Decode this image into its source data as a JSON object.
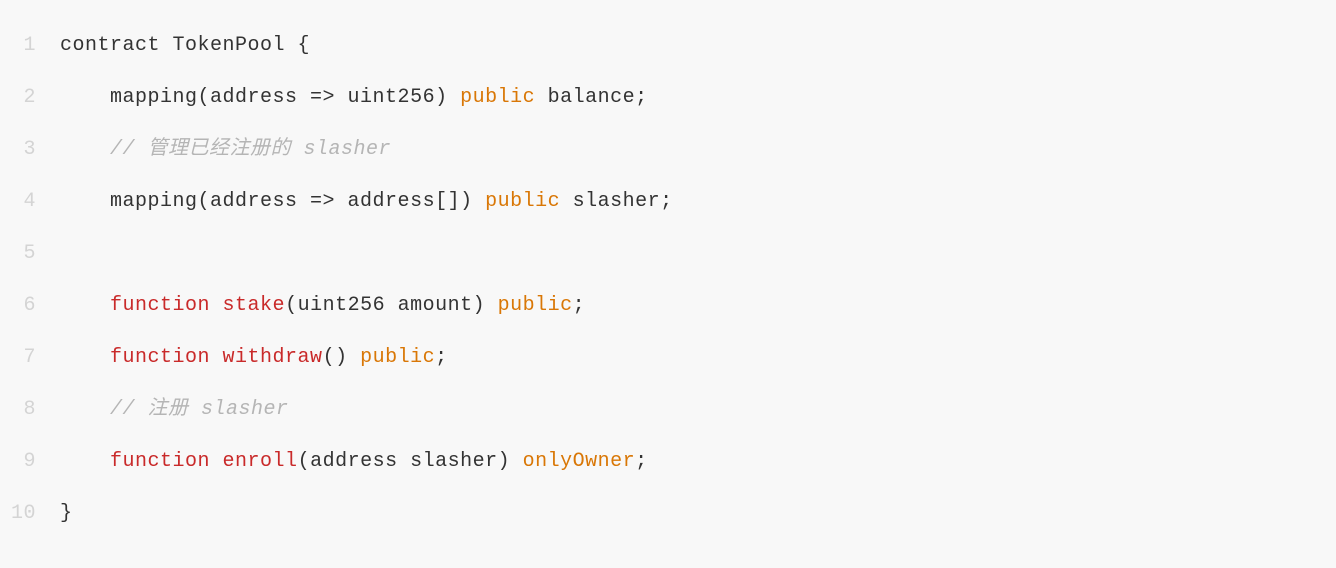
{
  "code": {
    "lines": [
      {
        "num": "1",
        "indent": 0,
        "tokens": [
          {
            "cls": "tok-default",
            "text": "contract TokenPool {"
          }
        ]
      },
      {
        "num": "2",
        "indent": 1,
        "tokens": [
          {
            "cls": "tok-default",
            "text": "mapping(address => uint256) "
          },
          {
            "cls": "tok-modifier",
            "text": "public"
          },
          {
            "cls": "tok-default",
            "text": " balance;"
          }
        ]
      },
      {
        "num": "3",
        "indent": 1,
        "tokens": [
          {
            "cls": "tok-comment",
            "text": "// 管理已经注册的 slasher"
          }
        ]
      },
      {
        "num": "4",
        "indent": 1,
        "tokens": [
          {
            "cls": "tok-default",
            "text": "mapping(address => address[]) "
          },
          {
            "cls": "tok-modifier",
            "text": "public"
          },
          {
            "cls": "tok-default",
            "text": " slasher;"
          }
        ]
      },
      {
        "num": "5",
        "indent": 0,
        "tokens": []
      },
      {
        "num": "6",
        "indent": 1,
        "tokens": [
          {
            "cls": "tok-keyword",
            "text": "function"
          },
          {
            "cls": "tok-default",
            "text": " "
          },
          {
            "cls": "tok-function",
            "text": "stake"
          },
          {
            "cls": "tok-default",
            "text": "(uint256 amount) "
          },
          {
            "cls": "tok-modifier",
            "text": "public"
          },
          {
            "cls": "tok-default",
            "text": ";"
          }
        ]
      },
      {
        "num": "7",
        "indent": 1,
        "tokens": [
          {
            "cls": "tok-keyword",
            "text": "function"
          },
          {
            "cls": "tok-default",
            "text": " "
          },
          {
            "cls": "tok-function",
            "text": "withdraw"
          },
          {
            "cls": "tok-default",
            "text": "() "
          },
          {
            "cls": "tok-modifier",
            "text": "public"
          },
          {
            "cls": "tok-default",
            "text": ";"
          }
        ]
      },
      {
        "num": "8",
        "indent": 1,
        "tokens": [
          {
            "cls": "tok-comment",
            "text": "// 注册 slasher"
          }
        ]
      },
      {
        "num": "9",
        "indent": 1,
        "tokens": [
          {
            "cls": "tok-keyword",
            "text": "function"
          },
          {
            "cls": "tok-default",
            "text": " "
          },
          {
            "cls": "tok-function",
            "text": "enroll"
          },
          {
            "cls": "tok-default",
            "text": "(address slasher) "
          },
          {
            "cls": "tok-modifier",
            "text": "onlyOwner"
          },
          {
            "cls": "tok-default",
            "text": ";"
          }
        ]
      },
      {
        "num": "10",
        "indent": 0,
        "tokens": [
          {
            "cls": "tok-default",
            "text": "}"
          }
        ]
      }
    ]
  }
}
